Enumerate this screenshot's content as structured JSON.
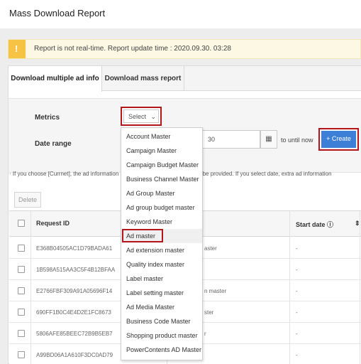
{
  "page": {
    "title": "Mass Download Report"
  },
  "notice": {
    "icon": "warning-icon",
    "text": "Report is not real-time. Report update time : 2020.09.30. 03:28"
  },
  "tabs": [
    {
      "label": "Download multiple ad info",
      "active": true
    },
    {
      "label": "Download mass report",
      "active": false
    }
  ],
  "form": {
    "metrics_label": "Metrics",
    "select_value": "Select",
    "date_range_label": "Date range",
    "date_value": "30",
    "until_text": "to until now",
    "create_label": "+ Create"
  },
  "hint": "· If you choose [Currnet], the ad information as of the current date & time will be provided. If you select date, extra ad information",
  "toolbar": {
    "delete_label": "Delete"
  },
  "table": {
    "headers": {
      "request_id": "Request ID",
      "start_date": "Start date ⓘ"
    },
    "rows": [
      {
        "request_id": "E368B04505AC1D79BADA61",
        "type": "aster",
        "start_date": "-"
      },
      {
        "request_id": "1B598A515AA3C5F4B12BFAA",
        "type": "",
        "start_date": "-"
      },
      {
        "request_id": "E2766FBF309A91A05696F14",
        "type": "n master",
        "start_date": "-"
      },
      {
        "request_id": "690FF1B0C4E4D2E1FC8673",
        "type": "ster",
        "start_date": "-"
      },
      {
        "request_id": "5806AFE85BEEC72B9B5EB7",
        "type": "r",
        "start_date": "-"
      },
      {
        "request_id": "A99BD06A1A610F3DC0AD79",
        "type": "",
        "start_date": "-"
      }
    ]
  },
  "dropdown": {
    "items": [
      "Account Master",
      "Campaign Master",
      "Campaign Budget Master",
      "Business Channel Master",
      "Ad Group Master",
      "Ad group budget master",
      "Keyword Master",
      "Ad master",
      "Ad extension master",
      "Quality index master",
      "Label master",
      "Label setting master",
      "Ad Media Master",
      "Business Code Master",
      "Shopping product master",
      "PowerContents AD Master"
    ],
    "highlighted_index": 7
  },
  "colors": {
    "highlight_border": "#b3171b",
    "primary": "#3d7ed6",
    "warning": "#f6c344"
  }
}
